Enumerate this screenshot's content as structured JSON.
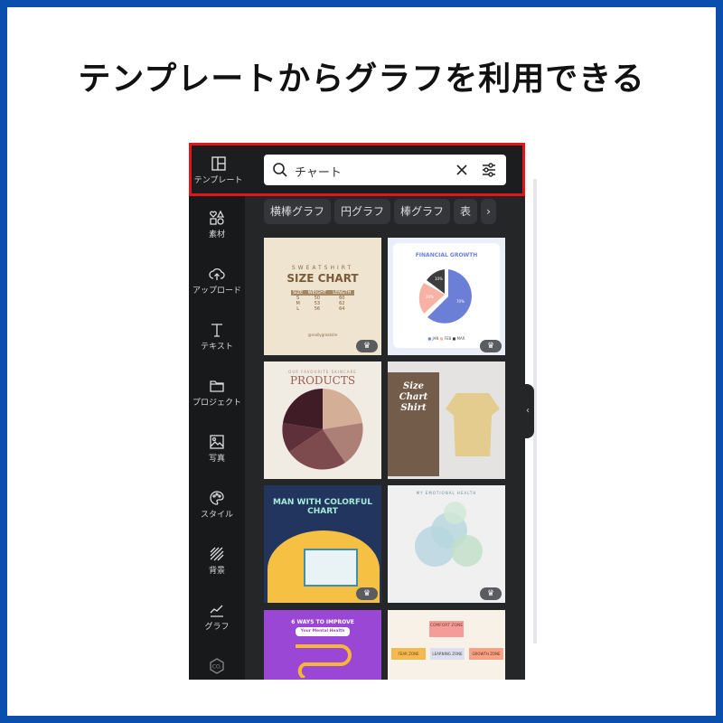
{
  "headline": "テンプレートからグラフを利用できる",
  "sidebar": {
    "items": [
      {
        "label": "テンプレート",
        "icon": "template-icon"
      },
      {
        "label": "素材",
        "icon": "elements-icon"
      },
      {
        "label": "アップロード",
        "icon": "cloud-upload-icon"
      },
      {
        "label": "テキスト",
        "icon": "text-icon"
      },
      {
        "label": "プロジェクト",
        "icon": "folder-icon"
      },
      {
        "label": "写真",
        "icon": "photo-icon"
      },
      {
        "label": "スタイル",
        "icon": "palette-icon"
      },
      {
        "label": "背景",
        "icon": "background-icon"
      },
      {
        "label": "グラフ",
        "icon": "chart-icon"
      },
      {
        "label": "CO.",
        "icon": "brand-icon"
      }
    ]
  },
  "search": {
    "value": "チャート"
  },
  "chips": [
    "横棒グラフ",
    "円グラフ",
    "棒グラフ",
    "表"
  ],
  "tiles": {
    "t1": {
      "kicker": "SWEATSHIRT",
      "title": "SIZE CHART",
      "headers": [
        "SIZE",
        "WEIGHT",
        "LENGTH"
      ],
      "rows": [
        [
          "S",
          "50",
          "60"
        ],
        [
          "M",
          "53",
          "62"
        ],
        [
          "L",
          "56",
          "64"
        ]
      ],
      "handle": "@reallygreatsite"
    },
    "t2": {
      "title": "FINANCIAL GROWTH",
      "slices": [
        "10%",
        "20%",
        "70%"
      ],
      "legend": [
        "JAN",
        "FEB",
        "MAR"
      ]
    },
    "t3": {
      "kicker": "OUR FAVOURITE SKINCARE",
      "title": "PRODUCTS"
    },
    "t4": {
      "title1": "Size",
      "title2": "Chart",
      "title3": "Shirt"
    },
    "t5": {
      "title": "MAN WITH COLORFUL CHART"
    },
    "t6": {
      "title": "MY EMOTIONAL HEALTH"
    },
    "t7": {
      "title": "6 WAYS TO IMPROVE",
      "subtitle": "Your Mental Health"
    },
    "t8": {
      "title": "COMFORT ZONE",
      "zones": [
        "FEAR ZONE",
        "LEARNING ZONE",
        "GROWTH ZONE"
      ]
    }
  },
  "colors": {
    "accent_red": "#e4141b",
    "frame_blue": "#0b4fae"
  }
}
